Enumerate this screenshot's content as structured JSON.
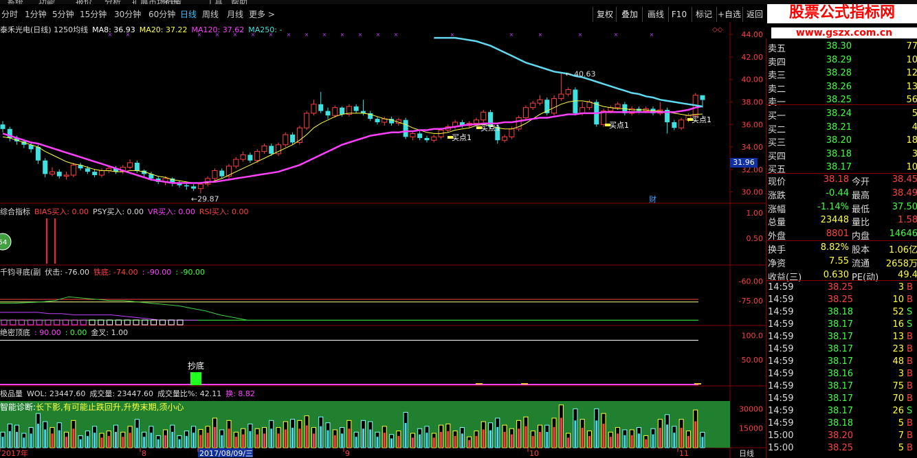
{
  "menubar": {
    "items": [
      "系统",
      "功能",
      "报价",
      "分析",
      "扩展市场行情",
      "资讯",
      "工具",
      "帮助"
    ]
  },
  "toolbar": {
    "timeframes": [
      "分时",
      "1分钟",
      "5分钟",
      "15分钟",
      "30分钟",
      "60分钟",
      "日线",
      "周线",
      "月线",
      "更多 >"
    ],
    "active_index": 6,
    "actions": [
      "复权",
      "叠加",
      "画线",
      "F10",
      "标记",
      "+自选",
      "返回"
    ]
  },
  "watermark": {
    "title": "股票公式指标网",
    "url": "www.gszx.com.cn"
  },
  "legend_main": {
    "title": "泰禾光电(日线) 1250均线",
    "items": [
      {
        "label": "MA8: 36.93",
        "color": "#ffffff"
      },
      {
        "label": "MA20: 37.22",
        "color": "#ffff40"
      },
      {
        "label": "MA120: 37.62",
        "color": "#ff40ff"
      },
      {
        "label": "MA250: -",
        "color": "#40e0e0"
      }
    ]
  },
  "legend_ind1": {
    "title": "综合指标",
    "items": [
      {
        "label": "BIAS买入: 0.00",
        "color": "#ff4040"
      },
      {
        "label": "PSY买入: 0.00",
        "color": "#dddddd"
      },
      {
        "label": "VR买入: 0.00",
        "color": "#ff40ff"
      },
      {
        "label": "RSI买入: 0.00",
        "color": "#ff4040"
      }
    ]
  },
  "legend_ind2": {
    "title": "千钧寻底(副",
    "items": [
      {
        "label": "伏击: -76.00",
        "color": "#dddddd"
      },
      {
        "label": "铁底: -74.00",
        "color": "#ff4040"
      },
      {
        "label": ": -90.00",
        "color": "#ff40ff"
      },
      {
        "label": ": -90.00",
        "color": "#40ff40"
      }
    ]
  },
  "legend_ind3": {
    "title": "绝密顶底",
    "items": [
      {
        "label": ": 90.00",
        "color": "#ff40ff"
      },
      {
        "label": ": 0.00",
        "color": "#40ff40"
      },
      {
        "label": "金叉: 1.00",
        "color": "#dddddd"
      }
    ]
  },
  "legend_vol": {
    "title": "极品量",
    "items": [
      {
        "label": "WOL: 23447.60",
        "color": "#dddddd"
      },
      {
        "label": "成交量: 23447.60",
        "color": "#dddddd"
      },
      {
        "label": "成交量比%: 42.11",
        "color": "#dddddd"
      },
      {
        "label": "换: 8.82",
        "color": "#ff40ff"
      }
    ]
  },
  "diagnosis": {
    "label": "智能诊断:",
    "text": "长下影,有可能止跌回升,升势末期,须小心"
  },
  "annotations": {
    "high": "40.63",
    "low": "29.87",
    "buy_label": "买点1",
    "bottom_label": "抄底",
    "badge": "54",
    "cai": "财"
  },
  "price_tag": "31.96",
  "axes": {
    "main": [
      "44.00",
      "42.00",
      "40.00",
      "38.00",
      "36.00",
      "34.00",
      "32.00",
      "30.00"
    ],
    "ind1": [
      "1.00",
      "0.50"
    ],
    "ind2": [
      "-60.00",
      "-75.00"
    ],
    "ind3": [
      "100.0",
      "50.00"
    ],
    "vol": [
      "30000",
      "15000"
    ],
    "dates": [
      "2017年",
      "8",
      "2017/08/09/三",
      "9",
      "10",
      "11"
    ],
    "period": "日线"
  },
  "orderbook": {
    "asks": [
      {
        "label": "卖五",
        "price": "38.30",
        "vol": "77"
      },
      {
        "label": "卖四",
        "price": "38.29",
        "vol": "10"
      },
      {
        "label": "卖三",
        "price": "38.28",
        "vol": "12"
      },
      {
        "label": "卖二",
        "price": "38.26",
        "vol": "13"
      },
      {
        "label": "卖一",
        "price": "38.25",
        "vol": "56"
      }
    ],
    "bids": [
      {
        "label": "买一",
        "price": "38.24",
        "vol": "5"
      },
      {
        "label": "买二",
        "price": "38.21",
        "vol": "4"
      },
      {
        "label": "买三",
        "price": "38.20",
        "vol": "18"
      },
      {
        "label": "买四",
        "price": "38.18",
        "vol": "3"
      },
      {
        "label": "买五",
        "price": "38.17",
        "vol": "10"
      }
    ]
  },
  "quote": [
    {
      "l1": "现价",
      "v1": "38.18",
      "c1": "red",
      "l2": "今开",
      "v2": "38.45",
      "c2": "red"
    },
    {
      "l1": "涨跌",
      "v1": "-0.44",
      "c1": "green",
      "l2": "最高",
      "v2": "38.49",
      "c2": "red"
    },
    {
      "l1": "涨幅",
      "v1": "-1.14%",
      "c1": "green",
      "l2": "最低",
      "v2": "37.50",
      "c2": "green"
    },
    {
      "l1": "总量",
      "v1": "23448",
      "c1": "yellow",
      "l2": "量比",
      "v2": "1.58",
      "c2": "red"
    },
    {
      "l1": "外盘",
      "v1": "8801",
      "c1": "red",
      "l2": "内盘",
      "v2": "14646",
      "c2": "green"
    },
    {
      "l1": "换手",
      "v1": "8.82%",
      "c1": "yellow",
      "l2": "股本",
      "v2": "1.06亿",
      "c2": "yellow"
    },
    {
      "l1": "净资",
      "v1": "7.55",
      "c1": "yellow",
      "l2": "流通",
      "v2": "2658万",
      "c2": "yellow"
    },
    {
      "l1": "收益(三)",
      "v1": "0.630",
      "c1": "yellow",
      "l2": "PE(动)",
      "v2": "49.4",
      "c2": "yellow"
    }
  ],
  "ticks": [
    {
      "time": "14:59",
      "price": "38.25",
      "vol": "3",
      "flag": "B"
    },
    {
      "time": "14:59",
      "price": "38.25",
      "vol": "10",
      "flag": "B"
    },
    {
      "time": "14:59",
      "price": "38.18",
      "vol": "52",
      "flag": "S"
    },
    {
      "time": "14:59",
      "price": "38.17",
      "vol": "16",
      "flag": "S"
    },
    {
      "time": "14:59",
      "price": "38.17",
      "vol": "13",
      "flag": "B"
    },
    {
      "time": "14:59",
      "price": "38.17",
      "vol": "23",
      "flag": "B"
    },
    {
      "time": "14:59",
      "price": "38.17",
      "vol": "48",
      "flag": "B"
    },
    {
      "time": "14:59",
      "price": "38.16",
      "vol": "3",
      "flag": "B"
    },
    {
      "time": "14:59",
      "price": "38.17",
      "vol": "75",
      "flag": "B"
    },
    {
      "time": "14:59",
      "price": "38.17",
      "vol": "70",
      "flag": "B"
    },
    {
      "time": "14:59",
      "price": "38.17",
      "vol": "26",
      "flag": "S"
    },
    {
      "time": "14:59",
      "price": "38.18",
      "vol": "5",
      "flag": "B"
    },
    {
      "time": "15:00",
      "price": "38.20",
      "vol": "7",
      "flag": "B"
    },
    {
      "time": "15:00",
      "price": "38.25",
      "vol": "5",
      "flag": "B"
    }
  ],
  "chart_data": {
    "type": "candlestick",
    "ylim": [
      29,
      44.5
    ],
    "candles": [
      [
        36.0,
        35.6,
        36.3,
        35.3
      ],
      [
        35.6,
        34.8,
        35.8,
        34.5
      ],
      [
        34.8,
        34.5,
        35.0,
        34.2
      ],
      [
        34.5,
        34.2,
        34.7,
        33.9
      ],
      [
        34.2,
        33.8,
        34.4,
        33.5
      ],
      [
        34.0,
        32.8,
        34.2,
        32.5
      ],
      [
        32.8,
        31.6,
        33.0,
        31.3
      ],
      [
        31.6,
        31.8,
        32.2,
        31.4
      ],
      [
        31.8,
        31.4,
        32.0,
        31.2
      ],
      [
        31.4,
        31.5,
        31.8,
        31.1
      ],
      [
        31.5,
        32.4,
        32.6,
        31.3
      ],
      [
        32.4,
        32.1,
        32.6,
        31.9
      ],
      [
        32.1,
        31.8,
        32.3,
        31.6
      ],
      [
        31.8,
        31.5,
        32.0,
        31.3
      ],
      [
        31.5,
        31.9,
        32.1,
        31.3
      ],
      [
        31.9,
        32.1,
        32.3,
        31.7
      ],
      [
        32.1,
        31.8,
        32.3,
        31.6
      ],
      [
        31.8,
        32.2,
        32.4,
        31.6
      ],
      [
        32.2,
        32.6,
        32.9,
        32.0
      ],
      [
        32.6,
        31.9,
        32.8,
        31.7
      ],
      [
        31.9,
        31.6,
        32.0,
        31.3
      ],
      [
        31.6,
        31.2,
        31.8,
        31.0
      ],
      [
        31.2,
        30.9,
        31.4,
        30.7
      ],
      [
        30.9,
        31.2,
        31.4,
        30.6
      ],
      [
        31.2,
        30.8,
        31.3,
        30.5
      ],
      [
        30.8,
        30.6,
        31.0,
        30.4
      ],
      [
        30.6,
        30.5,
        30.8,
        30.2
      ],
      [
        30.5,
        30.3,
        30.7,
        30.1
      ],
      [
        30.3,
        30.7,
        30.9,
        29.87
      ],
      [
        30.7,
        31.2,
        31.4,
        30.5
      ],
      [
        31.2,
        31.9,
        32.1,
        30.9
      ],
      [
        31.9,
        31.4,
        32.1,
        31.2
      ],
      [
        31.4,
        32.3,
        32.5,
        31.2
      ],
      [
        32.3,
        32.9,
        33.1,
        32.1
      ],
      [
        32.9,
        33.3,
        33.6,
        32.7
      ],
      [
        33.3,
        32.8,
        33.5,
        32.6
      ],
      [
        32.8,
        33.6,
        33.8,
        32.6
      ],
      [
        33.6,
        34.1,
        34.3,
        33.4
      ],
      [
        34.1,
        33.4,
        34.3,
        33.2
      ],
      [
        33.4,
        34.2,
        34.4,
        33.2
      ],
      [
        34.2,
        35.1,
        35.3,
        34.0
      ],
      [
        35.1,
        34.4,
        35.3,
        34.2
      ],
      [
        34.4,
        35.7,
        35.9,
        34.2
      ],
      [
        35.7,
        37.0,
        37.2,
        35.5
      ],
      [
        37.0,
        37.8,
        38.2,
        36.8
      ],
      [
        37.8,
        37.2,
        38.9,
        37.0
      ],
      [
        37.2,
        36.8,
        37.5,
        36.5
      ],
      [
        36.8,
        37.5,
        37.7,
        36.6
      ],
      [
        37.5,
        36.9,
        37.6,
        36.7
      ],
      [
        36.9,
        37.6,
        37.8,
        36.7
      ],
      [
        37.6,
        37.2,
        37.8,
        37.0
      ],
      [
        37.2,
        37.0,
        38.2,
        36.8
      ],
      [
        37.0,
        36.5,
        37.2,
        36.3
      ],
      [
        36.5,
        36.2,
        36.7,
        36.0
      ],
      [
        36.2,
        36.5,
        36.7,
        35.9
      ],
      [
        36.5,
        36.1,
        36.7,
        35.9
      ],
      [
        36.1,
        36.4,
        36.6,
        35.9
      ],
      [
        36.4,
        34.9,
        36.6,
        34.7
      ],
      [
        34.9,
        35.2,
        35.4,
        34.6
      ],
      [
        35.2,
        34.8,
        35.4,
        34.6
      ],
      [
        34.8,
        34.6,
        35.0,
        34.4
      ],
      [
        34.6,
        34.9,
        35.1,
        34.4
      ],
      [
        34.9,
        35.5,
        35.7,
        34.7
      ],
      [
        35.5,
        35.8,
        36.0,
        35.3
      ],
      [
        35.8,
        36.2,
        36.4,
        35.6
      ],
      [
        36.2,
        35.9,
        36.4,
        35.7
      ],
      [
        35.9,
        36.1,
        36.3,
        35.7
      ],
      [
        36.1,
        36.4,
        36.6,
        35.9
      ],
      [
        36.4,
        37.1,
        37.3,
        36.2
      ],
      [
        37.1,
        35.8,
        37.3,
        35.6
      ],
      [
        35.8,
        34.6,
        36.0,
        34.3
      ],
      [
        34.6,
        34.9,
        35.1,
        34.4
      ],
      [
        34.9,
        35.6,
        35.8,
        34.7
      ],
      [
        35.6,
        36.6,
        36.8,
        35.4
      ],
      [
        36.6,
        37.5,
        37.7,
        36.4
      ],
      [
        37.5,
        37.9,
        38.1,
        37.3
      ],
      [
        37.9,
        38.2,
        38.6,
        37.7
      ],
      [
        38.2,
        37.0,
        38.4,
        36.8
      ],
      [
        37.0,
        38.3,
        38.6,
        36.8
      ],
      [
        38.3,
        38.7,
        40.63,
        38.1
      ],
      [
        38.7,
        39.1,
        39.3,
        38.5
      ],
      [
        39.1,
        37.0,
        39.3,
        36.8
      ],
      [
        37.0,
        37.5,
        38.0,
        36.8
      ],
      [
        37.5,
        38.0,
        38.2,
        37.3
      ],
      [
        38.0,
        36.0,
        38.2,
        35.8
      ],
      [
        36.0,
        37.2,
        37.4,
        35.8
      ],
      [
        37.2,
        37.5,
        37.7,
        37.0
      ],
      [
        37.5,
        37.8,
        38.0,
        37.3
      ],
      [
        37.8,
        37.0,
        38.0,
        36.8
      ],
      [
        37.0,
        37.4,
        37.6,
        36.8
      ],
      [
        37.4,
        37.2,
        37.6,
        37.0
      ],
      [
        37.2,
        37.4,
        37.6,
        37.0
      ],
      [
        37.4,
        37.0,
        37.6,
        36.8
      ],
      [
        37.0,
        37.3,
        38.0,
        36.8
      ],
      [
        37.3,
        36.2,
        37.5,
        35.2
      ],
      [
        36.2,
        35.7,
        36.4,
        35.5
      ],
      [
        35.7,
        36.4,
        36.6,
        35.5
      ],
      [
        36.4,
        36.8,
        37.0,
        36.2
      ],
      [
        36.8,
        38.6,
        38.8,
        36.6
      ],
      [
        38.6,
        38.18,
        38.49,
        37.5
      ]
    ],
    "ma_yellow": [
      34.9,
      34.8,
      34.6,
      34.4,
      34.2,
      34.0,
      33.6,
      33.3,
      33.0,
      32.7,
      32.5,
      32.4,
      32.2,
      32.0,
      31.9,
      31.9,
      31.8,
      31.8,
      31.9,
      31.9,
      31.8,
      31.6,
      31.4,
      31.3,
      31.1,
      31.0,
      30.9,
      30.8,
      30.8,
      30.8,
      31.0,
      31.2,
      31.5,
      31.8,
      32.1,
      32.4,
      32.7,
      33.0,
      33.3,
      33.6,
      33.9,
      34.2,
      34.6,
      35.1,
      35.7,
      36.1,
      36.4,
      36.7,
      36.9,
      37.0,
      37.0,
      37.0,
      36.9,
      36.7,
      36.5,
      36.4,
      36.2,
      36.0,
      35.7,
      35.5,
      35.3,
      35.2,
      35.2,
      35.3,
      35.5,
      35.6,
      35.7,
      35.9,
      36.0,
      35.9,
      35.7,
      35.6,
      35.6,
      35.8,
      36.1,
      36.5,
      36.9,
      37.2,
      37.5,
      37.8,
      38.0,
      38.1,
      38.1,
      38.0,
      37.8,
      37.6,
      37.5,
      37.4,
      37.4,
      37.3,
      37.3,
      37.3,
      37.2,
      37.2,
      37.1,
      37.0,
      36.9,
      36.8,
      36.9,
      36.93
    ],
    "ma_magenta": [
      35.2,
      35.0,
      34.8,
      34.6,
      34.4,
      34.3,
      34.1,
      33.9,
      33.7,
      33.5,
      33.3,
      33.1,
      32.9,
      32.7,
      32.5,
      32.3,
      32.1,
      31.9,
      31.7,
      31.5,
      31.3,
      31.1,
      31.0,
      30.9,
      30.8,
      30.8,
      30.8,
      30.8,
      30.8,
      30.9,
      30.9,
      31.0,
      31.1,
      31.2,
      31.3,
      31.4,
      31.5,
      31.6,
      31.7,
      31.8,
      32.0,
      32.2,
      32.4,
      32.7,
      33.0,
      33.3,
      33.6,
      33.9,
      34.2,
      34.4,
      34.6,
      34.8,
      35.0,
      35.1,
      35.2,
      35.3,
      35.3,
      35.4,
      35.4,
      35.5,
      35.5,
      35.6,
      35.6,
      35.7,
      35.8,
      35.9,
      36.0,
      36.0,
      36.1,
      36.1,
      36.1,
      36.2,
      36.2,
      36.3,
      36.4,
      36.5,
      36.6,
      36.6,
      36.7,
      36.8,
      36.9,
      36.9,
      37.0,
      37.0,
      37.0,
      37.1,
      37.1,
      37.1,
      37.1,
      37.1,
      37.1,
      37.1,
      37.1,
      37.1,
      37.1,
      37.1,
      37.2,
      37.3,
      37.5,
      37.62
    ],
    "ma_cyan": [
      43.7,
      43.7,
      43.7,
      43.7,
      43.6,
      43.5,
      43.4,
      43.2,
      43.0,
      42.7,
      42.4,
      42.1,
      41.8,
      41.5,
      41.3,
      41.1,
      40.9,
      40.7,
      40.6,
      40.5,
      40.3,
      40.2,
      40.0,
      39.8,
      39.6,
      39.4,
      39.2,
      39.0,
      38.8,
      38.7,
      38.5,
      38.4,
      38.2,
      38.1,
      38.0,
      37.9,
      37.8,
      37.7,
      37.6
    ]
  }
}
